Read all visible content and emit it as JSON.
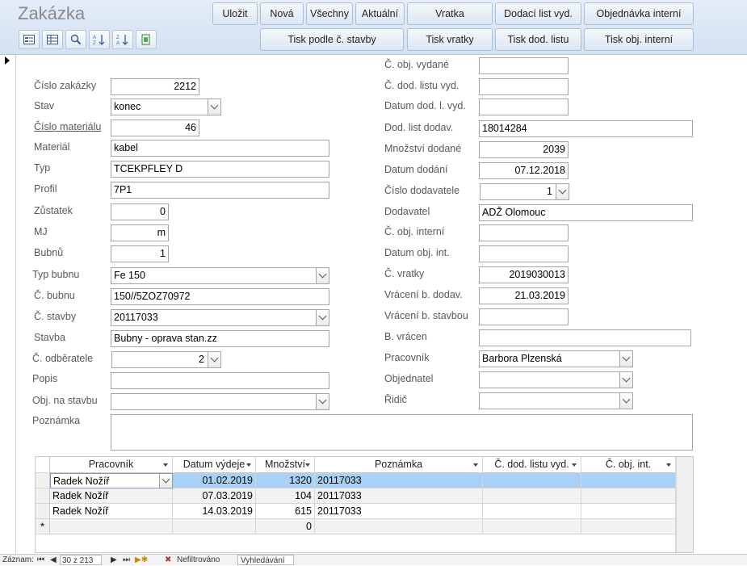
{
  "app_title": "Zakázka",
  "toolbar": {
    "ulozit": "Uložit",
    "nova": "Nová",
    "vsechny": "Všechny",
    "aktualni": "Aktuální",
    "vratka": "Vratka",
    "dodaci_list_vyd": "Dodací list vyd.",
    "objednavka_interni": "Objednávka interní",
    "tisk_podle_stavby": "Tisk podle č. stavby",
    "tisk_vratky": "Tisk vratky",
    "tisk_dod_listu": "Tisk dod. listu",
    "tisk_obj_interni": "Tisk obj. interní"
  },
  "left": {
    "cislo_zakazky": {
      "label": "Číslo zakázky",
      "value": "2212"
    },
    "stav": {
      "label": "Stav",
      "value": "konec"
    },
    "cislo_materialu": {
      "label": "Číslo materiálu",
      "value": "46"
    },
    "material": {
      "label": "Materiál",
      "value": "kabel"
    },
    "typ": {
      "label": "Typ",
      "value": "TCEKPFLEY D"
    },
    "profil": {
      "label": "Profil",
      "value": "7P1"
    },
    "zustatek": {
      "label": "Zůstatek",
      "value": "0"
    },
    "mj": {
      "label": "MJ",
      "value": "m"
    },
    "bubnu": {
      "label": "Bubnů",
      "value": "1"
    },
    "typ_bubnu": {
      "label": "Typ bubnu",
      "value": "Fe 150"
    },
    "c_bubnu": {
      "label": "Č. bubnu",
      "value": "150//5ZOZ70972"
    },
    "c_stavby": {
      "label": "Č. stavby",
      "value": "20117033"
    },
    "stavba": {
      "label": "Stavba",
      "value": "Bubny - oprava stan.zz"
    },
    "c_odberatele": {
      "label": "Č. odběratele",
      "value": "2"
    },
    "popis": {
      "label": "Popis",
      "value": ""
    },
    "obj_na_stavbu": {
      "label": "Obj. na stavbu",
      "value": ""
    },
    "poznamka": {
      "label": "Poznámka",
      "value": ""
    }
  },
  "right": {
    "c_obj_vydane": {
      "label": "Č. obj. vydané",
      "value": ""
    },
    "c_dod_listu_vyd": {
      "label": "Č. dod. listu vyd.",
      "value": ""
    },
    "datum_dod_l_vyd": {
      "label": "Datum dod. l. vyd.",
      "value": ""
    },
    "dod_list_dodav": {
      "label": "Dod. list dodav.",
      "value": "18014284"
    },
    "mnozstvi_dodane": {
      "label": "Množství dodané",
      "value": "2039"
    },
    "datum_dodani": {
      "label": "Datum dodání",
      "value": "07.12.2018"
    },
    "cislo_dodavatele": {
      "label": "Číslo dodavatele",
      "value": "1"
    },
    "dodavatel": {
      "label": "Dodavatel",
      "value": "ADŽ Olomouc"
    },
    "c_obj_interni": {
      "label": "Č. obj. interní",
      "value": ""
    },
    "datum_obj_int": {
      "label": "Datum obj. int.",
      "value": ""
    },
    "c_vratky": {
      "label": "Č. vratky",
      "value": "2019030013"
    },
    "vraceni_b_dodav": {
      "label": "Vrácení b. dodav.",
      "value": "21.03.2019"
    },
    "vraceni_b_stavbou": {
      "label": "Vrácení b. stavbou",
      "value": ""
    },
    "b_vracen": {
      "label": "B. vrácen",
      "value": ""
    },
    "pracovnik": {
      "label": "Pracovník",
      "value": "Barbora Plzenská"
    },
    "objednatel": {
      "label": "Objednatel",
      "value": ""
    },
    "ridic": {
      "label": "Řidič",
      "value": ""
    }
  },
  "grid": {
    "headers": [
      "Pracovník",
      "Datum výdeje",
      "Množství",
      "Poznámka",
      "Č. dod. listu vyd.",
      "Č. obj. int."
    ],
    "rows": [
      [
        "Radek Nožíř",
        "01.02.2019",
        "1320",
        "20117033",
        "",
        ""
      ],
      [
        "Radek Nožíř",
        "07.03.2019",
        "104",
        "20117033",
        "",
        ""
      ],
      [
        "Radek Nožíř",
        "14.03.2019",
        "615",
        "20117033",
        "",
        ""
      ]
    ],
    "new_row_marker": "*",
    "new_row_mnozstvi": "0"
  },
  "status": {
    "zaznam_label": "Záznam:",
    "record": "30 z 213",
    "filter": "Nefiltrováno",
    "search": "Vyhledávání"
  }
}
